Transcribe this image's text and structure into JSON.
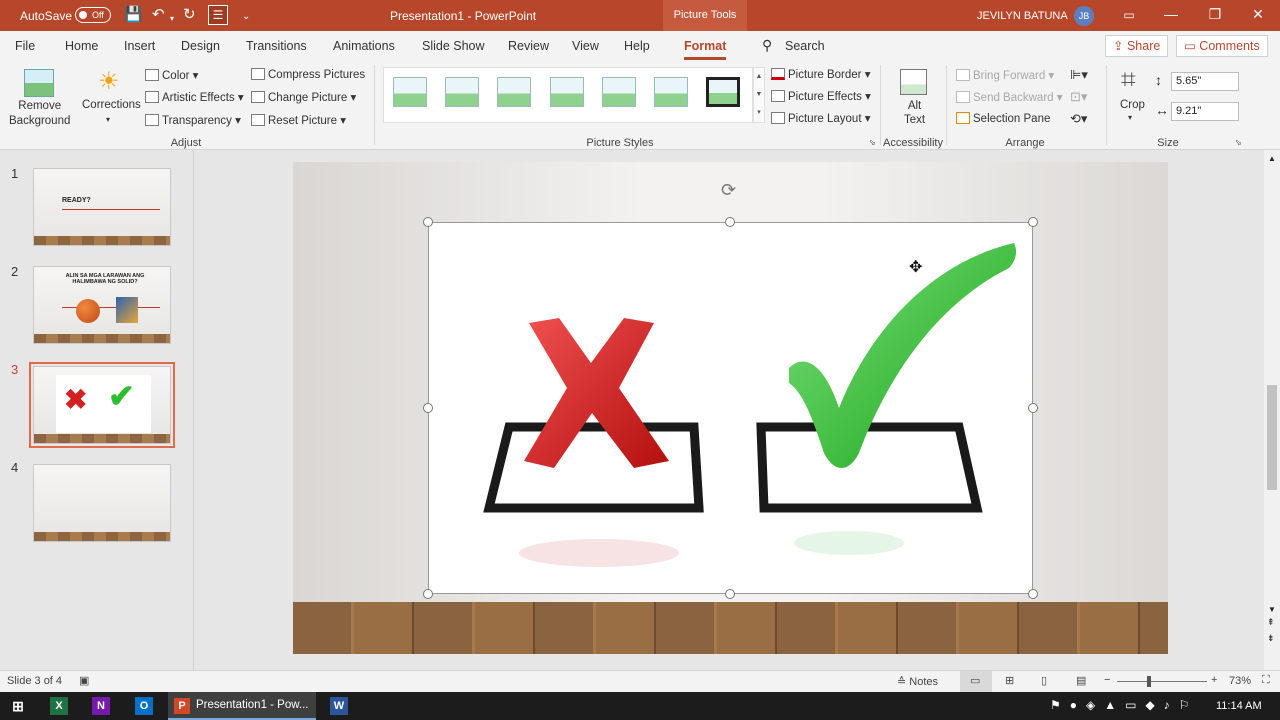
{
  "titlebar": {
    "autosave_label": "AutoSave",
    "autosave_state": "Off",
    "document_title": "Presentation1  -  PowerPoint",
    "context_tab": "Picture Tools",
    "user_name": "JEVILYN BATUNA",
    "user_initials": "JB"
  },
  "tabs": [
    "File",
    "Home",
    "Insert",
    "Design",
    "Transitions",
    "Animations",
    "Slide Show",
    "Review",
    "View",
    "Help",
    "Format"
  ],
  "active_tab": "Format",
  "search_label": "Search",
  "share_label": "Share",
  "comments_label": "Comments",
  "ribbon": {
    "adjust": {
      "remove_bg": "Remove Background",
      "remove_bg_l1": "Remove",
      "remove_bg_l2": "Background",
      "corrections": "Corrections",
      "color": "Color",
      "artistic": "Artistic Effects",
      "transparency": "Transparency",
      "compress": "Compress Pictures",
      "change": "Change Picture",
      "reset": "Reset Picture",
      "group": "Adjust"
    },
    "picture_styles": {
      "border": "Picture Border",
      "effects": "Picture Effects",
      "layout": "Picture Layout",
      "group": "Picture Styles"
    },
    "accessibility": {
      "alt_l1": "Alt",
      "alt_l2": "Text",
      "group": "Accessibility"
    },
    "arrange": {
      "bring_forward": "Bring Forward",
      "send_backward": "Send Backward",
      "selection_pane": "Selection Pane",
      "group": "Arrange"
    },
    "size": {
      "crop": "Crop",
      "height": "5.65\"",
      "width": "9.21\"",
      "group": "Size"
    }
  },
  "slides": [
    {
      "number": "1",
      "text": "READY?"
    },
    {
      "number": "2",
      "text": "ALIN SA MGA LARAWAN ANG HALIMBAWA NG SOLID?"
    },
    {
      "number": "3",
      "text": ""
    },
    {
      "number": "4",
      "text": ""
    }
  ],
  "selected_slide": 3,
  "status": {
    "slide_info": "Slide 3 of 4",
    "notes": "Notes",
    "zoom": "73%"
  },
  "taskbar": {
    "app_label": "Presentation1 - Pow...",
    "time": "11:14 AM"
  },
  "colors": {
    "accent": "#b7472a",
    "x_red": "#d42020",
    "check_green": "#2ebd2e"
  }
}
